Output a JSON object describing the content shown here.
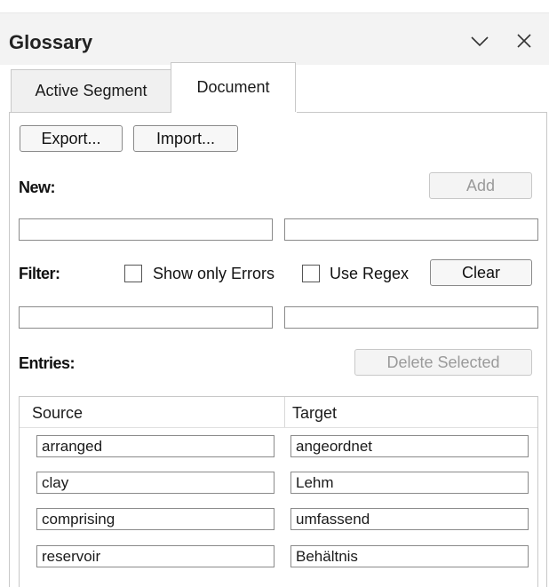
{
  "panel": {
    "title": "Glossary"
  },
  "tabs": [
    {
      "label": "Active Segment",
      "active": false
    },
    {
      "label": "Document",
      "active": true
    }
  ],
  "toolbar": {
    "export_label": "Export...",
    "import_label": "Import..."
  },
  "new_entry": {
    "label": "New:",
    "add_label": "Add",
    "source_value": "",
    "target_value": ""
  },
  "filter": {
    "label": "Filter:",
    "show_only_errors_label": "Show only Errors",
    "show_only_errors_checked": false,
    "use_regex_label": "Use Regex",
    "use_regex_checked": false,
    "clear_label": "Clear",
    "source_value": "",
    "target_value": ""
  },
  "entries": {
    "label": "Entries:",
    "delete_selected_label": "Delete Selected",
    "columns": [
      "Source",
      "Target"
    ],
    "rows": [
      {
        "source": "arranged",
        "target": "angeordnet"
      },
      {
        "source": "clay",
        "target": "Lehm"
      },
      {
        "source": "comprising",
        "target": "umfassend"
      },
      {
        "source": "reservoir",
        "target": "Behältnis"
      }
    ]
  },
  "colors": {
    "header_bg": "#f3f3f3",
    "border": "#c8c8c8",
    "disabled_text": "#9a9a9a"
  }
}
